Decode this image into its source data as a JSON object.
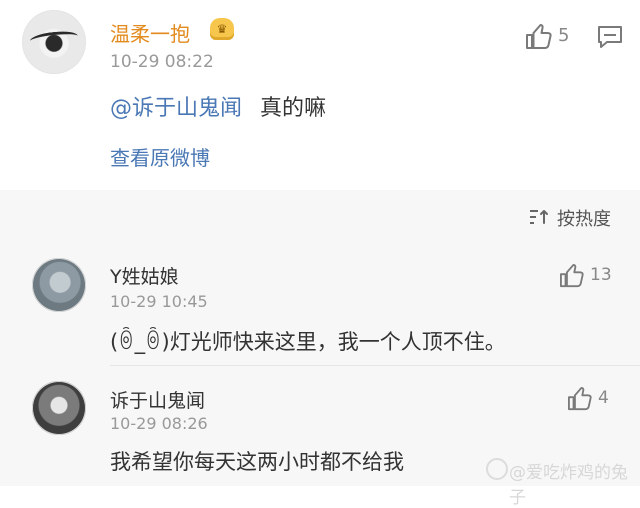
{
  "top_comment": {
    "username": "温柔一抱",
    "time": "10-29 08:22",
    "likes": "5",
    "mention": "@诉于山鬼闻",
    "message": "真的嘛",
    "view_original": "查看原微博"
  },
  "sort": {
    "label": "按热度"
  },
  "replies": [
    {
      "username": "Y姓姑娘",
      "time": "10-29 10:45",
      "likes": "13",
      "text": "(ꉺ_ꉺ)灯光师快来这里，我一个人顶不住。"
    },
    {
      "username": "诉于山鬼闻",
      "time": "10-29 08:26",
      "likes": "4",
      "text": "我希望你每天这两小时都不给我"
    }
  ],
  "watermark": {
    "text": "@爱吃炸鸡的兔子"
  },
  "colors": {
    "username_main": "#e38a1e",
    "link": "#4a78b5",
    "secondary_text": "#999999"
  },
  "icons": {
    "top_like": "thumbs-up-icon",
    "top_comment": "comment-icon",
    "sort": "sort-icon",
    "reply_like": "thumbs-up-icon",
    "watermark": "weibo-icon"
  }
}
